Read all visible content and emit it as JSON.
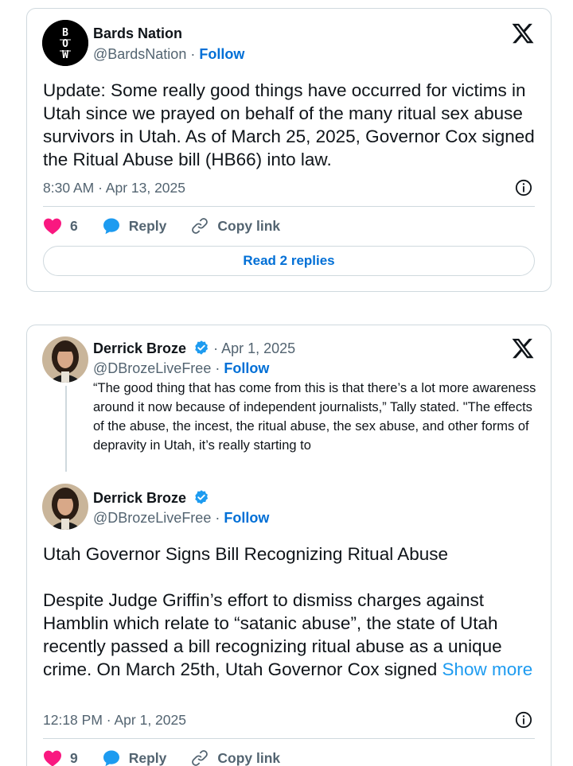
{
  "tweet1": {
    "author_name": "Bards Nation",
    "handle": "@BardsNation",
    "separator": "·",
    "follow_label": "Follow",
    "avatar_initials": [
      "B",
      "O",
      "W"
    ],
    "text": "Update: Some really good things have occurred for victims in Utah since we prayed on behalf of the many ritual sex abuse survivors in Utah. As of March 25, 2025, Governor Cox signed the Ritual Abuse bill (HB66) into law.",
    "timestamp": "8:30 AM · Apr 13, 2025",
    "like_count": "6",
    "reply_label": "Reply",
    "copy_link_label": "Copy link",
    "read_replies_label": "Read 2 replies"
  },
  "tweet2": {
    "quoted": {
      "author_name": "Derrick Broze",
      "date": "· Apr 1, 2025",
      "handle": "@DBrozeLiveFree",
      "separator": "·",
      "follow_label": "Follow",
      "text": "“The good thing that has come from this is that there’s a lot more awareness around it now because of independent journalists,” Tally stated. \"The  effects of the abuse, the incest, the ritual abuse, the sex abuse, and  other forms of depravity in Utah, it’s really starting to"
    },
    "main": {
      "author_name": "Derrick Broze",
      "handle": "@DBrozeLiveFree",
      "separator": "·",
      "follow_label": "Follow",
      "headline": "Utah Governor Signs Bill Recognizing Ritual Abuse",
      "text": "Despite  Judge Griffin’s effort to dismiss charges against Hamblin which relate  to “satanic abuse”, the state of Utah recently passed a bill recognizing  ritual abuse as a unique crime. On March 25th, Utah Governor Cox signed ",
      "show_more_label": "Show more",
      "timestamp": "12:18 PM · Apr 1, 2025",
      "like_count": "9",
      "reply_label": "Reply",
      "copy_link_label": "Copy link"
    }
  },
  "colors": {
    "like": "#f91880",
    "reply": "#1d9bf0",
    "link": "#006fd6",
    "verified": "#1d9bf0"
  },
  "icons": [
    "x-logo-icon",
    "info-icon",
    "heart-icon",
    "reply-bubble-icon",
    "link-icon",
    "verified-badge-icon"
  ]
}
